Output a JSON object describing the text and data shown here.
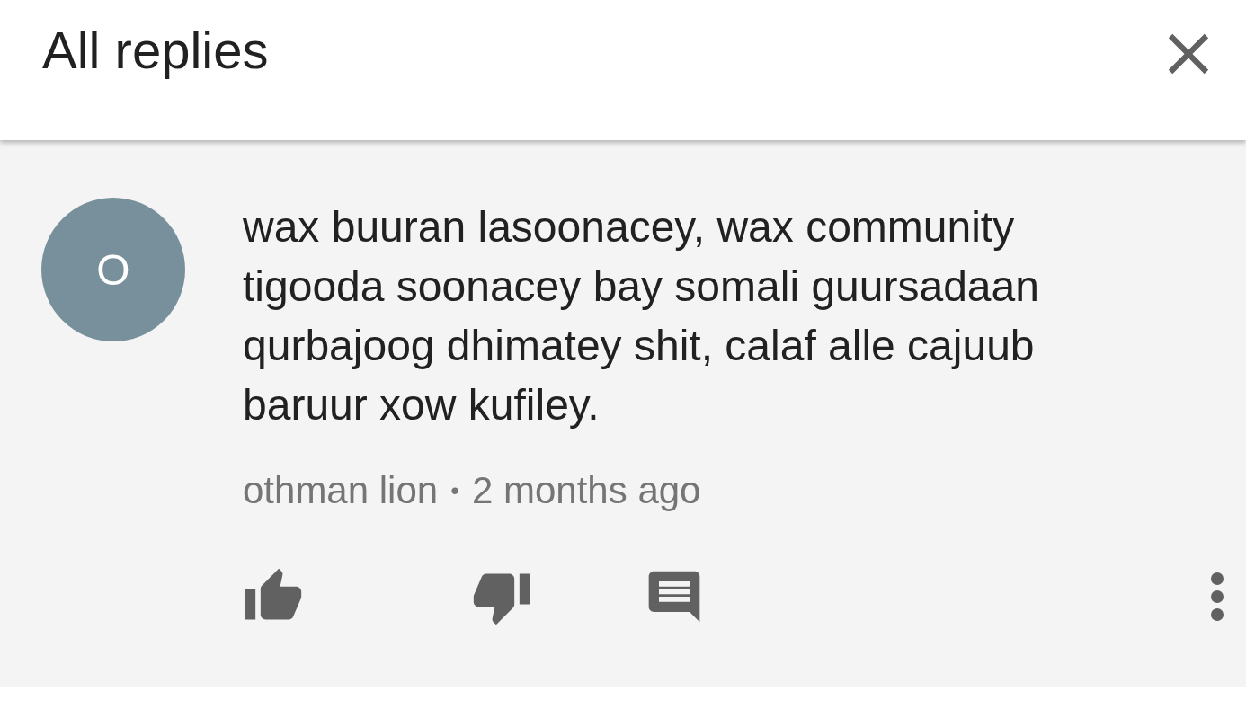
{
  "header": {
    "title": "All replies"
  },
  "comment": {
    "avatar_letter": "O",
    "text": "wax buuran lasoonacey, wax community tigooda soonacey bay somali guursadaan qurbajoog dhimatey shit, calaf alle cajuub baruur xow kufiley.",
    "author": "othman lion",
    "separator": "•",
    "time": "2 months ago"
  }
}
